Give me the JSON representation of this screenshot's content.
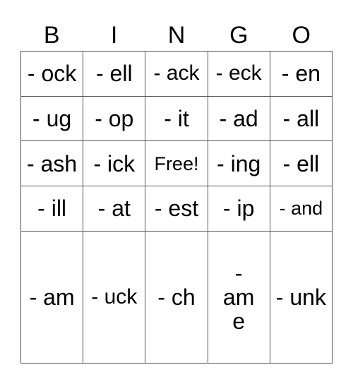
{
  "header": [
    "B",
    "I",
    "N",
    "G",
    "O"
  ],
  "rows": [
    [
      "- ock",
      "- ell",
      "- ack",
      "- eck",
      "- en"
    ],
    [
      "- ug",
      "- op",
      "- it",
      "- ad",
      "- all"
    ],
    [
      "- ash",
      "- ick",
      "Free!",
      "- ing",
      "- ell"
    ],
    [
      "- ill",
      "- at",
      "- est",
      "- ip",
      "- and"
    ],
    [
      "- am",
      "- uck",
      "- ch",
      "- ame",
      "- unk"
    ]
  ]
}
